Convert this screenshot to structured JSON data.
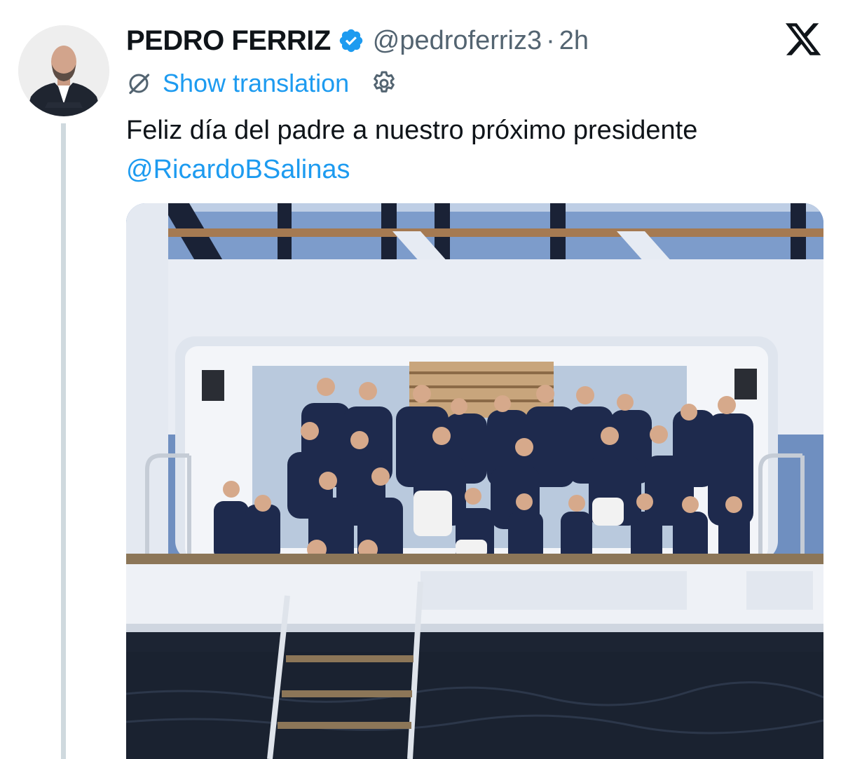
{
  "tweet": {
    "display_name": "PEDRO FERRIZ",
    "handle": "@pedroferriz3",
    "separator": "·",
    "time": "2h",
    "show_translation": "Show translation",
    "text": "Feliz día del padre a nuestro próximo presidente",
    "mention": "@RicardoBSalinas"
  },
  "icons": {
    "verified": "verified-badge-icon",
    "brand": "x-logo-icon",
    "translate": "globe-slash-icon",
    "settings": "gear-icon"
  },
  "colors": {
    "link_blue": "#1d9bf0",
    "verified_blue": "#1d9bf0",
    "text": "#0f1419",
    "secondary_text": "#536471",
    "thread_line": "#cfd9de"
  }
}
